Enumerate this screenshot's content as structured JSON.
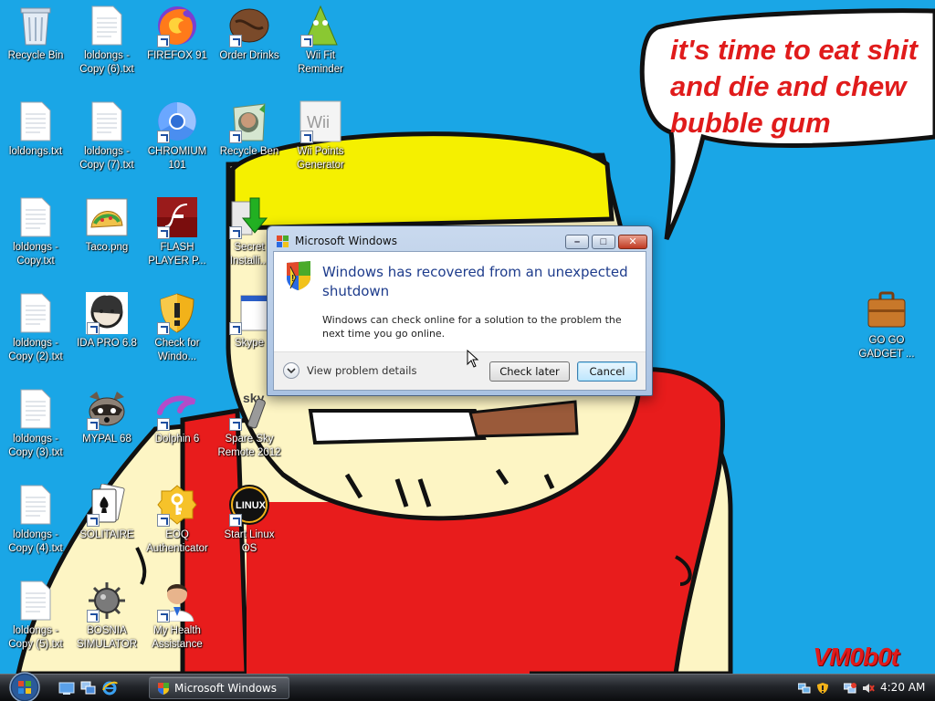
{
  "desktop": {
    "icons": [
      {
        "label": "Recycle Bin",
        "icon": "recycle-bin-icon"
      },
      {
        "label": "loldongs -\nCopy (6).txt",
        "icon": "text-file-icon"
      },
      {
        "label": "FIREFOX 91",
        "icon": "firefox-icon"
      },
      {
        "label": "Order Drinks",
        "icon": "coffee-bean-icon"
      },
      {
        "label": "Wii Fit\nReminder",
        "icon": "wii-fit-icon"
      },
      {
        "label": "loldongs.txt",
        "icon": "text-file-icon"
      },
      {
        "label": "loldongs -\nCopy (7).txt",
        "icon": "text-file-icon"
      },
      {
        "label": "CHROMIUM\n101",
        "icon": "chromium-icon"
      },
      {
        "label": "Recycle Ben",
        "icon": "recycle-ben-icon"
      },
      {
        "label": "Wii Points\nGenerator",
        "icon": "wii-icon"
      },
      {
        "label": "loldongs -\nCopy.txt",
        "icon": "text-file-icon"
      },
      {
        "label": "Taco.png",
        "icon": "taco-icon"
      },
      {
        "label": "FLASH\nPLAYER P...",
        "icon": "flash-icon"
      },
      {
        "label": "Secret\nInstalli...",
        "icon": "installer-icon"
      },
      {
        "label": "loldongs -\nCopy (2).txt",
        "icon": "text-file-icon"
      },
      {
        "label": "IDA PRO 6.8",
        "icon": "ida-pro-icon"
      },
      {
        "label": "Check for\nWindo...",
        "icon": "shield-icon"
      },
      {
        "label": "Skype",
        "icon": "skype-icon"
      },
      {
        "label": "GO GO\nGADGET ...",
        "icon": "briefcase-icon"
      },
      {
        "label": "loldongs -\nCopy (3).txt",
        "icon": "text-file-icon"
      },
      {
        "label": "MYPAL 68",
        "icon": "raccoon-icon"
      },
      {
        "label": "Dolphin 6",
        "icon": "dolphin-icon"
      },
      {
        "label": "Spare Sky\nRemote 2012",
        "icon": "sky-remote-icon"
      },
      {
        "label": "loldongs -\nCopy (4).txt",
        "icon": "text-file-icon"
      },
      {
        "label": "SOLITAIRE",
        "icon": "solitaire-icon"
      },
      {
        "label": "EOQ\nAuthenticator",
        "icon": "key-icon"
      },
      {
        "label": "Start Linux\nOS",
        "icon": "linux-icon"
      },
      {
        "label": "loldongs -\nCopy (5).txt",
        "icon": "text-file-icon"
      },
      {
        "label": "BOSNIA\nSIMULATOR",
        "icon": "mine-icon"
      },
      {
        "label": "My Health\nAssistance",
        "icon": "doctor-icon"
      }
    ],
    "wallpaper_text": "it's time to eat shit\nand die and chew\nbubble gum",
    "signature": "VM0b0t"
  },
  "dialog": {
    "title": "Microsoft Windows",
    "main_instruction": "Windows has recovered from an unexpected shutdown",
    "content": "Windows can check online for a solution to the problem the next time you go online.",
    "details_label": "View problem details",
    "check_later": "Check later",
    "cancel": "Cancel"
  },
  "taskbar": {
    "task_label": "Microsoft Windows",
    "clock": "4:20 AM"
  },
  "colors": {
    "wallpaper_sky": "#1aa6e6",
    "hair": "#f5f000",
    "skin": "#fdf5c4",
    "shirt": "#e81c1c",
    "bubble_text": "#e01b1b"
  }
}
